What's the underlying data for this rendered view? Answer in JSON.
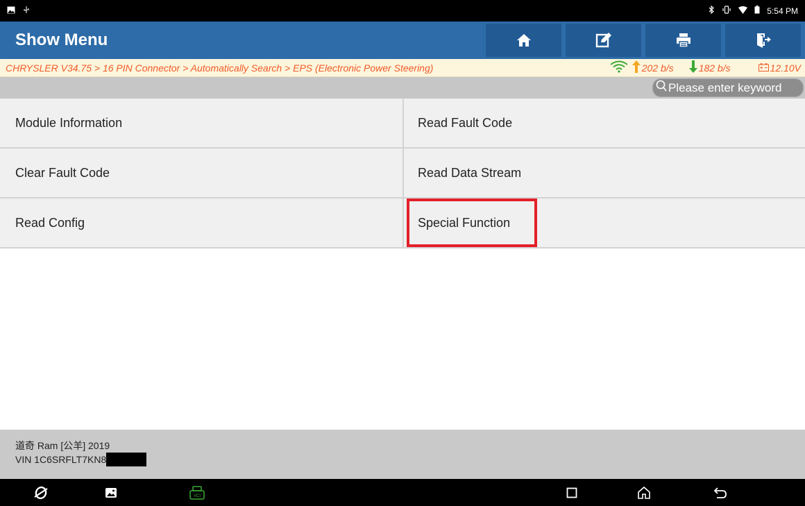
{
  "status_bar": {
    "left_icons": [
      "image-icon",
      "usb-icon"
    ],
    "right_icons": [
      "bluetooth-icon",
      "vibrate-icon",
      "wifi-icon",
      "battery-icon"
    ],
    "time": "5:54 PM"
  },
  "header": {
    "title": "Show Menu",
    "buttons": [
      "home-icon",
      "edit-report-icon",
      "print-icon",
      "exit-icon"
    ]
  },
  "breadcrumb": {
    "path": "CHRYSLER V34.75 > 16 PIN Connector > Automatically Search > EPS (Electronic Power Steering)",
    "upload": "202 b/s",
    "download": "182 b/s",
    "voltage": "12.10V"
  },
  "search": {
    "placeholder": "Please enter keyword"
  },
  "menu": {
    "items": [
      {
        "label": "Module Information"
      },
      {
        "label": "Read Fault Code"
      },
      {
        "label": "Clear Fault Code"
      },
      {
        "label": "Read Data Stream"
      },
      {
        "label": "Read Config"
      },
      {
        "label": "Special Function",
        "highlighted": true
      }
    ]
  },
  "vehicle": {
    "model_line": "道奇 Ram [公羊] 2019",
    "vin_line": "VIN 1C6SRFLT7KN8"
  },
  "nav_bar": {
    "icons": [
      "browser-icon",
      "gallery-icon",
      "vci-icon",
      "recents-icon",
      "home-nav-icon",
      "back-icon"
    ]
  },
  "colors": {
    "header_bg": "#2d6ca8",
    "header_button_bg": "#225a94",
    "breadcrumb_bg": "#fdf6dd",
    "breadcrumb_text": "#f05a28",
    "menu_bg": "#f0f0f0",
    "highlight_border": "#e3202a",
    "up_arrow": "#f5a623",
    "down_arrow": "#3aa935",
    "wifi": "#3aa935"
  }
}
